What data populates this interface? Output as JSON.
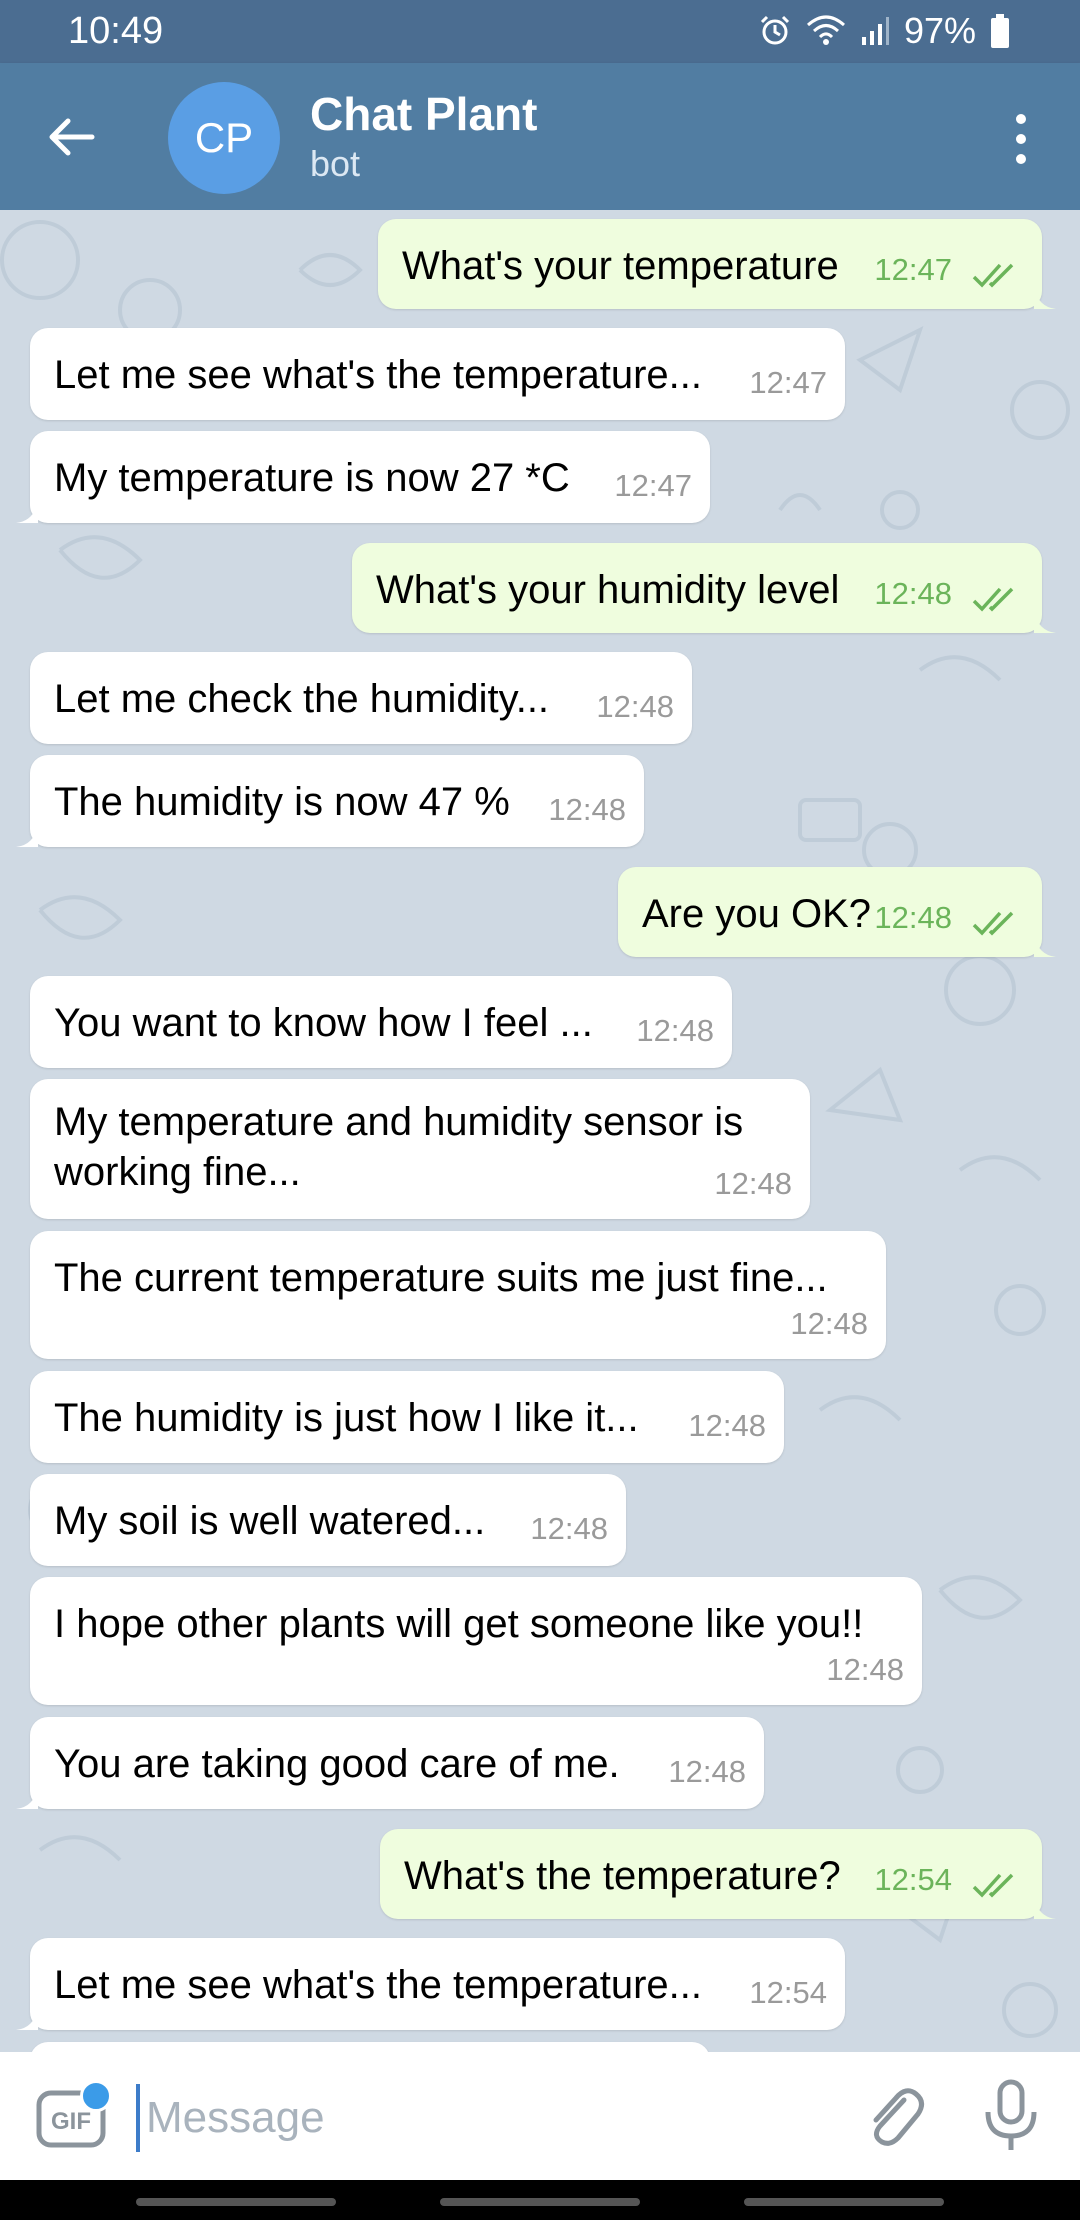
{
  "status": {
    "time": "10:49",
    "battery": "97%"
  },
  "header": {
    "avatar_initials": "CP",
    "title": "Chat Plant",
    "subtitle": "bot"
  },
  "messages": [
    {
      "dir": "out",
      "text": "What's your temperature",
      "time": "12:47"
    },
    {
      "dir": "in",
      "text": "Let me see what's the temperature...",
      "time": "12:47"
    },
    {
      "dir": "in",
      "text": "My temperature is now 27 *C",
      "time": "12:47"
    },
    {
      "dir": "out",
      "text": "What's your humidity level",
      "time": "12:48"
    },
    {
      "dir": "in",
      "text": "Let me check the humidity...",
      "time": "12:48"
    },
    {
      "dir": "in",
      "text": "The humidity is now 47 %",
      "time": "12:48"
    },
    {
      "dir": "out",
      "text": "Are you OK?",
      "time": "12:48"
    },
    {
      "dir": "in",
      "text": "You want to know how I feel ...",
      "time": "12:48"
    },
    {
      "dir": "in",
      "text": "My temperature and humidity sensor is\nworking fine...",
      "time": "12:48"
    },
    {
      "dir": "in",
      "text": "The current temperature suits me just fine...",
      "time": "12:48"
    },
    {
      "dir": "in",
      "text": "The humidity is just how I like it...",
      "time": "12:48"
    },
    {
      "dir": "in",
      "text": "My soil is well watered...",
      "time": "12:48"
    },
    {
      "dir": "in",
      "text": "I hope other plants will get someone like you!!",
      "time": "12:48"
    },
    {
      "dir": "in",
      "text": "You are taking good care of me.",
      "time": "12:48"
    },
    {
      "dir": "out",
      "text": "What's the temperature?",
      "time": "12:54"
    },
    {
      "dir": "in",
      "text": "Let me see what's the temperature...",
      "time": "12:54"
    }
  ],
  "composer": {
    "gif_label": "GIF",
    "placeholder": "Message"
  },
  "colors": {
    "header": "#517da2",
    "statusbar": "#4b6d91",
    "outgoing": "#effdde",
    "incoming": "#ffffff",
    "read_check": "#6bb45a"
  }
}
